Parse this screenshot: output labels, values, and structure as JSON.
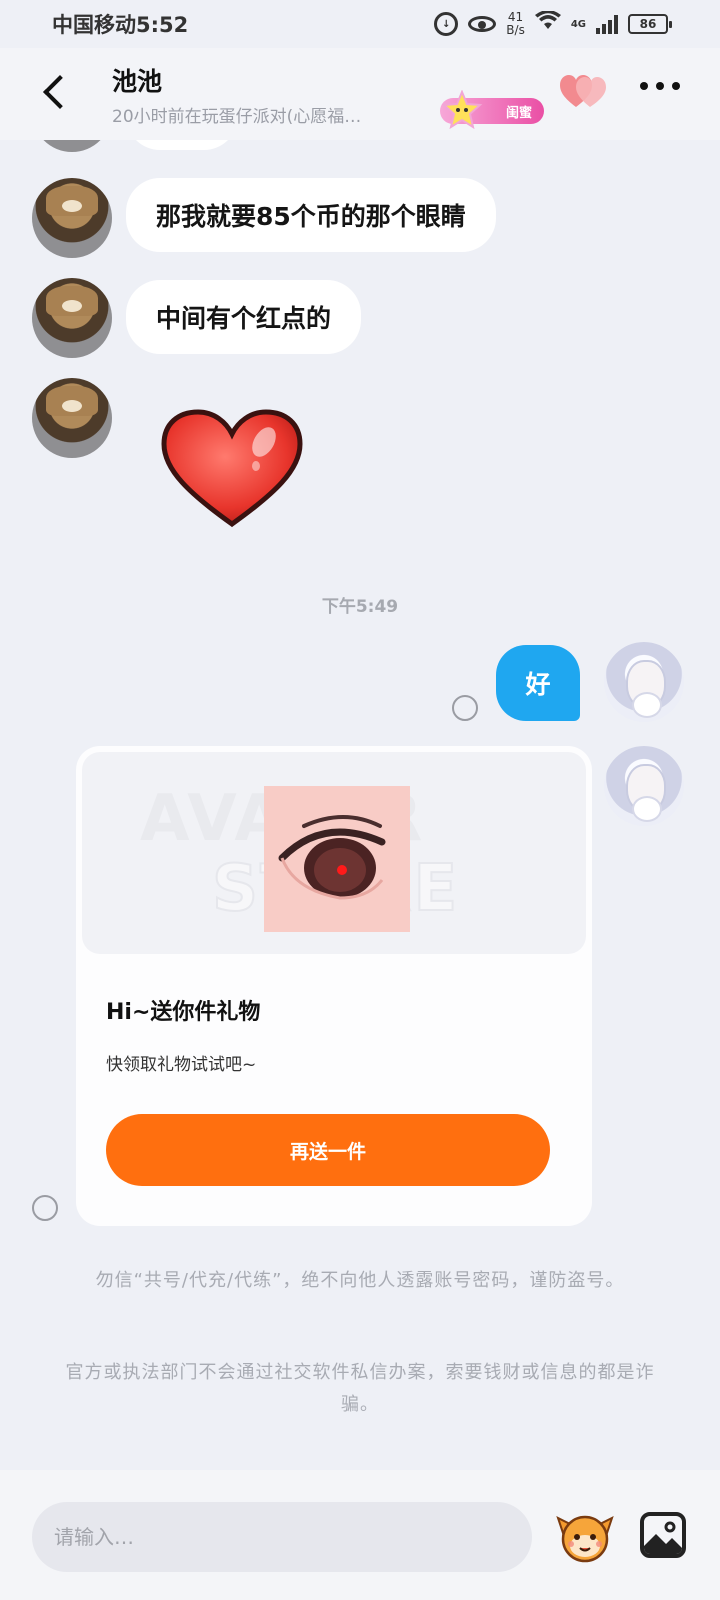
{
  "status_bar": {
    "carrier_time": "中国移动5:52",
    "net_speed_value": "41",
    "net_speed_unit": "B/s",
    "network_type": "4G",
    "battery": "86"
  },
  "header": {
    "name": "池池",
    "status": "20小时前在玩蛋仔派对(心愿福…",
    "relation_badge": "闺蜜"
  },
  "messages": {
    "top_in_1": "那我就要85个币的那个眼睛",
    "top_in_2": "中间有个红点的",
    "timestamp": "下午5:49",
    "out_1": "好"
  },
  "gift_card": {
    "watermark_line1": "AVATAR",
    "watermark_line2": "STORE",
    "title": "Hi~送你件礼物",
    "description": "快领取礼物试试吧~",
    "button_label": "再送一件"
  },
  "notices": {
    "notice_1": "勿信“共号/代充/代练”，绝不向他人透露账号密码，谨防盗号。",
    "notice_2": "官方或执法部门不会通过社交软件私信办案，索要钱财或信息的都是诈骗。"
  },
  "input_bar": {
    "placeholder": "请输入…"
  },
  "colors": {
    "accent_blue": "#1fa7f0",
    "accent_orange": "#ff6f0f",
    "badge_pink": "#ea4fa5"
  },
  "icons": [
    "back-arrow-icon",
    "heart-icon",
    "more-icon",
    "emoji-icon",
    "image-icon"
  ]
}
